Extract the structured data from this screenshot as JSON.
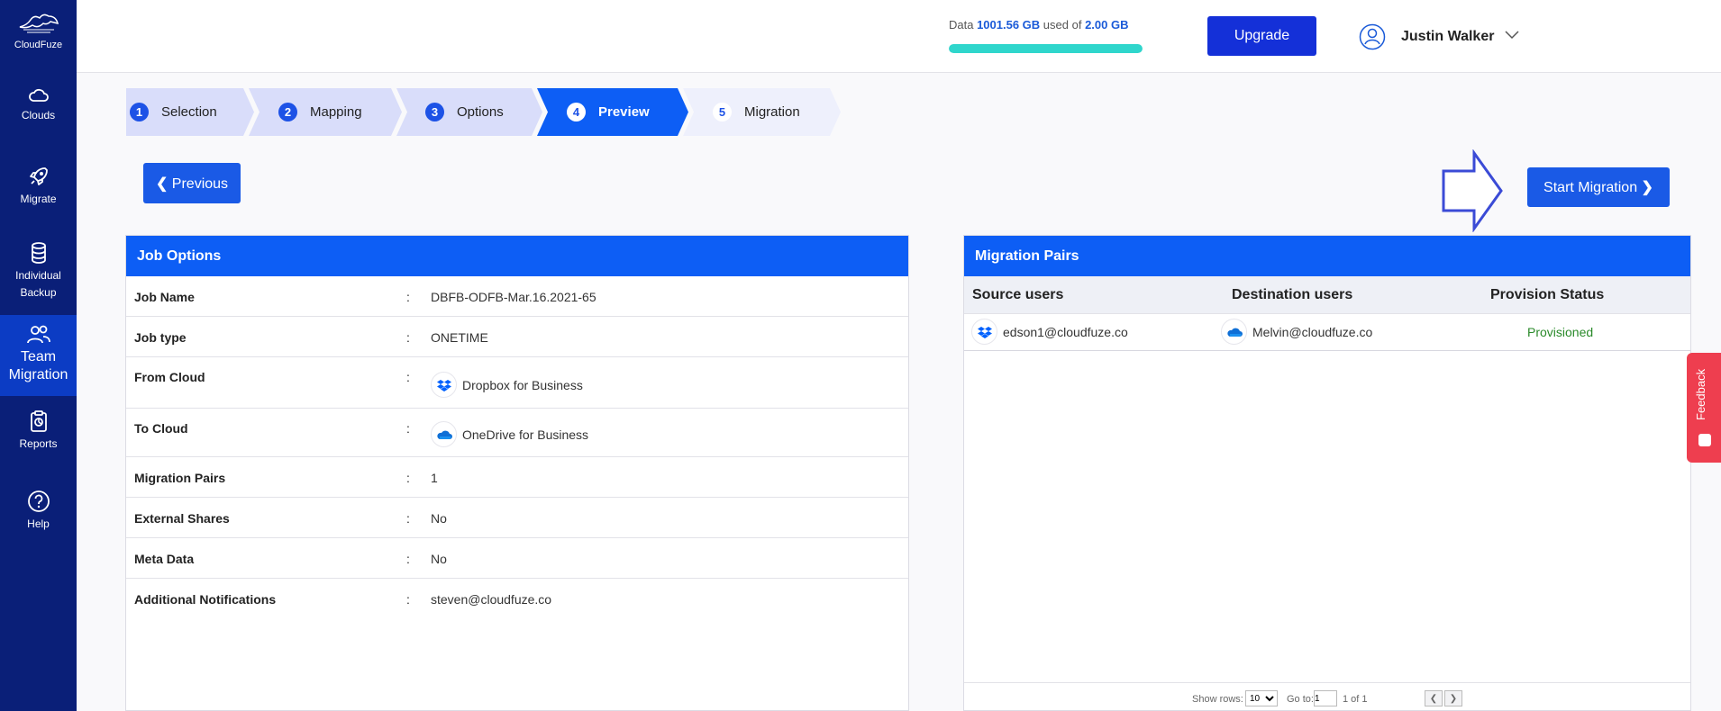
{
  "app": {
    "name": "CloudFuze"
  },
  "sidebar": {
    "items": [
      {
        "label": "Clouds",
        "icon": "cloud-icon"
      },
      {
        "label": "Migrate",
        "icon": "rocket-icon"
      },
      {
        "label": "Individual Backup",
        "icon": "database-icon"
      },
      {
        "label": "Team Migration",
        "icon": "users-icon",
        "active": true
      },
      {
        "label": "Reports",
        "icon": "report-icon"
      },
      {
        "label": "Help",
        "icon": "help-icon"
      }
    ]
  },
  "header": {
    "usage_prefix": "Data ",
    "usage_used": "1001.56 GB",
    "usage_mid": " used of ",
    "usage_total": "2.00 GB",
    "usage_fraction": 1.0,
    "upgrade_label": "Upgrade",
    "user_name": "Justin Walker"
  },
  "steps": [
    {
      "num": "1",
      "label": "Selection",
      "state": "done"
    },
    {
      "num": "2",
      "label": "Mapping",
      "state": "done"
    },
    {
      "num": "3",
      "label": "Options",
      "state": "done"
    },
    {
      "num": "4",
      "label": "Preview",
      "state": "active"
    },
    {
      "num": "5",
      "label": "Migration",
      "state": "pending"
    }
  ],
  "buttons": {
    "previous_label": "Previous",
    "start_label": "Start Migration"
  },
  "job_options": {
    "title": "Job Options",
    "rows": [
      {
        "key": "Job Name",
        "value": "DBFB-ODFB-Mar.16.2021-65"
      },
      {
        "key": "Job type",
        "value": "ONETIME"
      },
      {
        "key": "From Cloud",
        "value": "Dropbox for Business",
        "icon": "dropbox-icon"
      },
      {
        "key": "To Cloud",
        "value": "OneDrive for Business",
        "icon": "onedrive-icon"
      },
      {
        "key": "Migration Pairs",
        "value": "1"
      },
      {
        "key": "External Shares",
        "value": "No"
      },
      {
        "key": "Meta Data",
        "value": "No"
      },
      {
        "key": "Additional Notifications",
        "value": "steven@cloudfuze.co"
      }
    ]
  },
  "migration_pairs": {
    "title": "Migration Pairs",
    "columns": [
      "Source users",
      "Destination users",
      "Provision Status"
    ],
    "rows": [
      {
        "source": "edson1@cloudfuze.co",
        "destination": "Melvin@cloudfuze.co",
        "status": "Provisioned"
      }
    ],
    "pager": {
      "show_rows_label": "Show rows:",
      "rows_value": "10",
      "goto_label": "Go to:",
      "goto_value": "1",
      "page_info": "1 of 1"
    }
  },
  "feedback_label": "Feedback",
  "colors": {
    "sidebar": "#0a1f78",
    "primary": "#0d5ef5",
    "upgrade": "#1430d8",
    "usage_bar": "#2fd6cc",
    "provisioned": "#2a8a2a",
    "feedback": "#ee3e4f"
  }
}
